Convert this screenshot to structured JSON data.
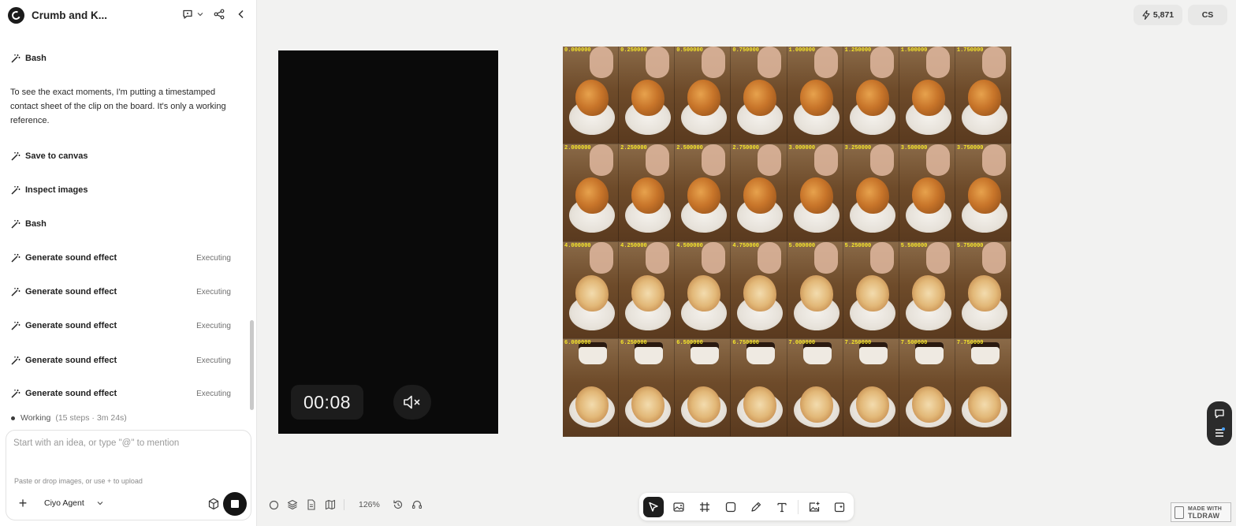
{
  "header": {
    "project_title": "Crumb and K..."
  },
  "steps": [
    {
      "label": "Bash",
      "status": ""
    },
    {
      "label": "Save to canvas",
      "status": ""
    },
    {
      "label": "Inspect images",
      "status": ""
    },
    {
      "label": "Bash",
      "status": ""
    },
    {
      "label": "Generate sound effect",
      "status": "Executing"
    },
    {
      "label": "Generate sound effect",
      "status": "Executing"
    },
    {
      "label": "Generate sound effect",
      "status": "Executing"
    },
    {
      "label": "Generate sound effect",
      "status": "Executing"
    },
    {
      "label": "Generate sound effect",
      "status": "Executing"
    }
  ],
  "message": "To see the exact moments, I'm putting a timestamped contact sheet of the clip on the board. It's only a working reference.",
  "working": {
    "label": "Working",
    "meta": "(15 steps · 3m 24s)"
  },
  "composer": {
    "placeholder": "Start with an idea, or type \"@\" to mention",
    "upload_hint": "Paste or drop images, or use + to upload",
    "add_label": "+",
    "agent": "Ciyo Agent"
  },
  "topbar": {
    "credits": "5,871",
    "avatar": "CS"
  },
  "video": {
    "timecode": "00:08",
    "muted": true
  },
  "contact_sheet": {
    "timestamps": [
      "0.000000",
      "0.250000",
      "0.500000",
      "0.750000",
      "1.000000",
      "1.250000",
      "1.500000",
      "1.750000",
      "2.000000",
      "2.250000",
      "2.500000",
      "2.750000",
      "3.000000",
      "3.250000",
      "3.500000",
      "3.750000",
      "4.000000",
      "4.250000",
      "4.500000",
      "4.750000",
      "5.000000",
      "5.250000",
      "5.500000",
      "5.750000",
      "6.000000",
      "6.250000",
      "6.500000",
      "6.750000",
      "7.000000",
      "7.250000",
      "7.500000",
      "7.750000"
    ]
  },
  "bottom": {
    "zoom": "126%"
  },
  "badge": {
    "line1": "MADE WITH",
    "line2": "TLDRAW"
  },
  "icons": {
    "logo": "ciyo-logo",
    "header": [
      "comment-icon",
      "chevron-down-icon",
      "share-icon",
      "collapse-panel-icon"
    ],
    "toolbar": [
      "select-icon",
      "image-gen-icon",
      "frame-icon",
      "rectangle-icon",
      "pencil-icon",
      "text-icon",
      "add-image-icon",
      "ai-image-icon"
    ]
  }
}
